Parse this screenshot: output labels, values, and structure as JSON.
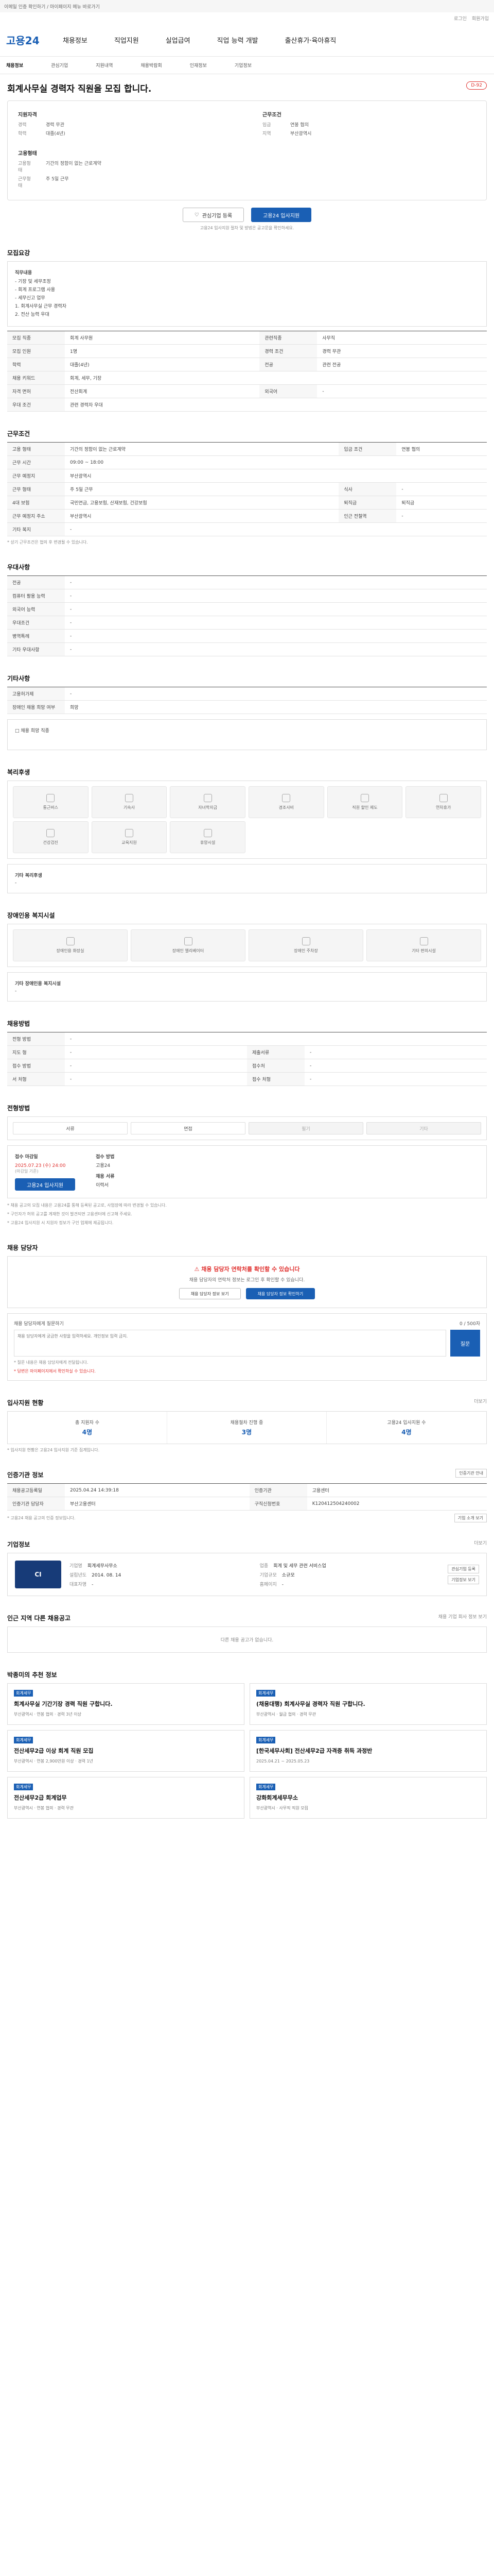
{
  "topbar": {
    "text": "이메일 인증 확인하기 / 마이페이지 메뉴 바로가기"
  },
  "topright": [
    "로그인",
    "회원가입"
  ],
  "header": {
    "logo": "고용24",
    "menu": [
      "채용정보",
      "직업지원",
      "실업급여",
      "직업 능력 개발",
      "출산휴가·육아휴직"
    ]
  },
  "subnav": [
    "채용정보",
    "관심기업",
    "지원내역",
    "채용박람회",
    "인재정보",
    "기업정보"
  ],
  "job": {
    "title": "회계사무실 경력자 직원을 모집 합니다.",
    "dday": "D-92",
    "summary": {
      "qual_head": "지원자격",
      "qual_rows": [
        {
          "k": "경력",
          "v": "경력 무관"
        },
        {
          "k": "학력",
          "v": "대졸(4년)"
        }
      ],
      "cond_head": "근무조건",
      "cond_rows": [
        {
          "k": "임금",
          "v": "연봉 협의"
        },
        {
          "k": "지역",
          "v": "부산광역시"
        }
      ],
      "emp_head": "고용형태",
      "emp_rows": [
        {
          "k": "고용형태",
          "v": "기간의 정함이 없는 근로계약"
        },
        {
          "k": "근무형태",
          "v": "주 5일 근무"
        }
      ]
    },
    "btn_interest": "관심기업 등록",
    "btn_apply": "고용24 입사지원",
    "notice": "고용24 입사지원 절차 및 방법은 공고문을 확인하세요."
  },
  "recruit": {
    "title": "모집요강",
    "box_head": "직무내용",
    "box_lines": [
      "- 기장 및 세무조정",
      "- 회계 프로그램 사용",
      "- 세무신고 업무",
      "1. 회계사무실 근무 경력자",
      "2. 전산 능력 우대"
    ],
    "rows": [
      {
        "k": "모집 직종",
        "v": "회계 사무원",
        "k2": "관련직종",
        "v2": "사무직"
      },
      {
        "k": "모집 인원",
        "v": "1명",
        "k2": "경력 조건",
        "v2": "경력 무관"
      },
      {
        "k": "학력",
        "v": "대졸(4년)",
        "k2": "전공",
        "v2": "관련 전공"
      },
      {
        "k": "채용 키워드",
        "v": "회계, 세무, 기장",
        "k2": "",
        "v2": ""
      },
      {
        "k": "자격 면허",
        "v": "전산회계",
        "k2": "외국어",
        "v2": "-"
      },
      {
        "k": "우대 조건",
        "v": "관련 경력자 우대",
        "k2": "",
        "v2": ""
      }
    ]
  },
  "conditions": {
    "title": "근무조건",
    "rows": [
      {
        "k": "고용 형태",
        "v": "기간의 정함이 없는 근로계약",
        "k2": "입금 조건",
        "v2": "연봉 협의"
      },
      {
        "k": "근무 시간",
        "v": "09:00 ~ 18:00",
        "k2": "",
        "v2": ""
      },
      {
        "k": "근무 예정지",
        "v": "부산광역시",
        "k2": "",
        "v2": ""
      },
      {
        "k": "근무 형태",
        "v": "주 5일 근무",
        "k2": "식사",
        "v2": "-"
      },
      {
        "k": "4대 보험",
        "v": "국민연금, 고용보험, 산재보험, 건강보험",
        "k2": "퇴직금",
        "v2": "퇴직금"
      },
      {
        "k": "근무 예정지 주소",
        "v": "부산광역시",
        "k2": "인근 전철역",
        "v2": "-"
      },
      {
        "k": "기타 복지",
        "v": "-",
        "k2": "",
        "v2": ""
      }
    ],
    "note": "* 상기 근무조건은 협의 후 변경될 수 있습니다."
  },
  "preference": {
    "title": "우대사항",
    "rows": [
      {
        "k": "전공",
        "v": "-"
      },
      {
        "k": "컴퓨터 활용 능력",
        "v": "-"
      },
      {
        "k": "외국어 능력",
        "v": "-"
      },
      {
        "k": "우대조건",
        "v": "-"
      },
      {
        "k": "병역특례",
        "v": "-"
      },
      {
        "k": "기타 우대사항",
        "v": "-"
      }
    ]
  },
  "etc": {
    "title": "기타사항",
    "rows": [
      {
        "k": "고용허가제",
        "v": "-"
      },
      {
        "k": "장애인 채용 희망 여부",
        "v": "희망"
      }
    ],
    "note": "□ 채용 희망 직종"
  },
  "welfare": {
    "title": "복리후생",
    "items": [
      "통근버스",
      "기숙사",
      "자녀학자금",
      "경조사비",
      "직원 할인 제도",
      "연차휴가",
      "건강검진",
      "교육지원",
      "휴양시설"
    ],
    "extra_head": "기타 복리후생",
    "extra": "-"
  },
  "disability": {
    "title": "장애인용 복지시설",
    "items": [
      "장애인용 화장실",
      "장애인 엘리베이터",
      "장애인 주차장",
      "기타 편의시설"
    ],
    "extra_head": "기타 장애인용 복지시설",
    "extra": "-"
  },
  "recruit_method": {
    "title": "채용방법",
    "rows": [
      {
        "k": "전형 방법",
        "v": "-",
        "k2": "",
        "v2": ""
      },
      {
        "k": "지도 형",
        "v": "-",
        "k2": "제출서류",
        "v2": "-"
      },
      {
        "k": "접수 방법",
        "v": "-",
        "k2": "접수처",
        "v2": "-"
      },
      {
        "k": "서 처형",
        "v": "-",
        "k2": "접수 처형",
        "v2": "-"
      }
    ]
  },
  "selection": {
    "title": "전형방법",
    "steps": [
      "서류",
      "면접",
      "필기",
      "기타"
    ],
    "deadline_head": "접수 마감일",
    "deadline": "2025.07.23 (수) 24:00",
    "deadline_note": "(마감일 기준)",
    "method_head": "접수 방법",
    "method": "고용24",
    "count_head": "채용 서류",
    "count": "이력서",
    "btn": "고용24 입사지원",
    "notes": [
      "* 채용 공고의 모집 내용은 고용24를 통해 등록된 공고로, 사업장에 따라 변경될 수 있습니다.",
      "* 구인자가 허위 공고를 게재한 것이 발견되면 고용센터에 신고해 주세요.",
      "* 고용24 입사지원 시 지원자 정보가 구인 업체에 제공됩니다."
    ]
  },
  "contact": {
    "title": "채용 담당자",
    "warn": "채용 담당자 연락처를 확인할 수 있습니다",
    "desc": "채용 담당자의 연락처 정보는 로그인 후 확인할 수 있습니다.",
    "btn1": "채용 담당자 정보 보기",
    "btn2": "채용 담당자 정보 확인하기",
    "qa_head": "채용 담당자에게 질문하기",
    "qa_count": "0 / 500자",
    "qa_placeholder": "채용 담당자에게 궁금한 사항을 입력하세요. 개인정보 입력 금지.",
    "qa_btn": "질문",
    "qa_notes": [
      "* 질문 내용은 채용 담당자에게 전달됩니다.",
      "* 답변은 마이페이지에서 확인하실 수 있습니다."
    ]
  },
  "stats": {
    "title": "입사지원 현황",
    "more": "더보기",
    "items": [
      {
        "k": "총 지원자 수",
        "v": "4명"
      },
      {
        "k": "채용절차 진행 중",
        "v": "3명"
      },
      {
        "k": "고용24 입사지원 수",
        "v": "4명"
      }
    ],
    "note": "* 입사지원 현황은 고용24 입사지원 기준 집계입니다."
  },
  "manager": {
    "title": "인증기관 정보",
    "btn": "인증기관 안내",
    "rows": [
      {
        "k": "채용공고등록일",
        "v": "2025.04.24 14:39:18",
        "k2": "인증기관",
        "v2": "고용센터"
      },
      {
        "k": "인증기관 담당자",
        "v": "부산고용센터",
        "k2": "구직신청번호",
        "v2": "K120412504240002"
      }
    ],
    "btn2": "기업 소개 보기",
    "note": "* 고용24 채용 공고의 인증 정보입니다."
  },
  "company": {
    "title": "기업정보",
    "more": "더보기",
    "logo": "CI",
    "rows": [
      {
        "k": "기업명",
        "v": "회계세무사무소"
      },
      {
        "k": "업종",
        "v": "회계 및 세무 관련 서비스업"
      },
      {
        "k": "설립년도",
        "v": "2014. 08. 14"
      },
      {
        "k": "기업규모",
        "v": "소규모"
      },
      {
        "k": "대표자명",
        "v": "-"
      },
      {
        "k": "홈페이지",
        "v": "-"
      }
    ],
    "btn1": "관심기업 등록",
    "btn2": "기업정보 보기"
  },
  "others": {
    "title": "인근 지역 다른 채용공고",
    "more": "채용 기업 회사 정보 보기",
    "empty": "다른 채용 공고가 없습니다."
  },
  "recommend": {
    "title": "박종미의 추천 정보",
    "items": [
      {
        "tag": "회계세무",
        "title": "회계사무실 기간기장 경력 직원 구합니다.",
        "meta": "부산광역시 · 연봉 협의 · 경력 3년 이상"
      },
      {
        "tag": "회계세무",
        "title": "(채용대행) 회계사무실 경력자 직원 구합니다.",
        "meta": "부산광역시 · 월급 협의 · 경력 무관"
      },
      {
        "tag": "회계세무",
        "title": "전산세무2급 이상 회계 직원 모집",
        "meta": "부산광역시 · 연봉 2,900만원 이상 · 경력 1년"
      },
      {
        "tag": "회계세무",
        "title": "[한국세무사회] 전산세무2급 자격증 취득 과정반",
        "meta": "2025.04.21 ~ 2025.05.23"
      },
      {
        "tag": "회계세무",
        "title": "전산세무2급 회계업무",
        "meta": "부산광역시 · 연봉 협의 · 경력 무관"
      },
      {
        "tag": "회계세무",
        "title": "강화회계세무무소",
        "meta": "부산광역시 · 사무직 직원 모집"
      }
    ]
  }
}
